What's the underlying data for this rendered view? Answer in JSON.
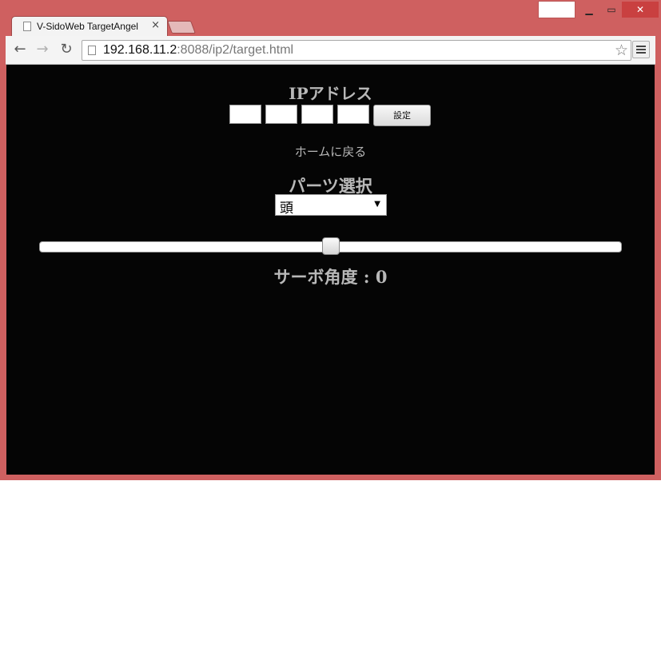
{
  "browser": {
    "tab_title": "V-SidoWeb TargetAngel",
    "tab_close": "×",
    "url_host": "192.168.11.2",
    "url_rest": ":8088/ip2/target.html",
    "icons": {
      "back": "arrow-left-icon",
      "forward": "arrow-right-icon",
      "reload": "reload-icon",
      "star": "star-icon",
      "menu": "hamburger-menu-icon",
      "minimize": "minimize-icon",
      "maximize": "maximize-icon",
      "close": "close-icon"
    }
  },
  "page": {
    "ip_heading": "IPアドレス",
    "ip_fields": [
      "",
      "",
      "",
      ""
    ],
    "set_button": "設定",
    "home_link": "ホームに戻る",
    "parts_heading": "パーツ選択",
    "parts_selected": "頭",
    "servo_label": "サーボ角度 : 0",
    "slider": {
      "value": 0,
      "position_fraction": 0.5
    }
  },
  "colors": {
    "window_frame": "#cf6060",
    "page_background": "#050505",
    "heading_text": "#b8b8b8"
  }
}
